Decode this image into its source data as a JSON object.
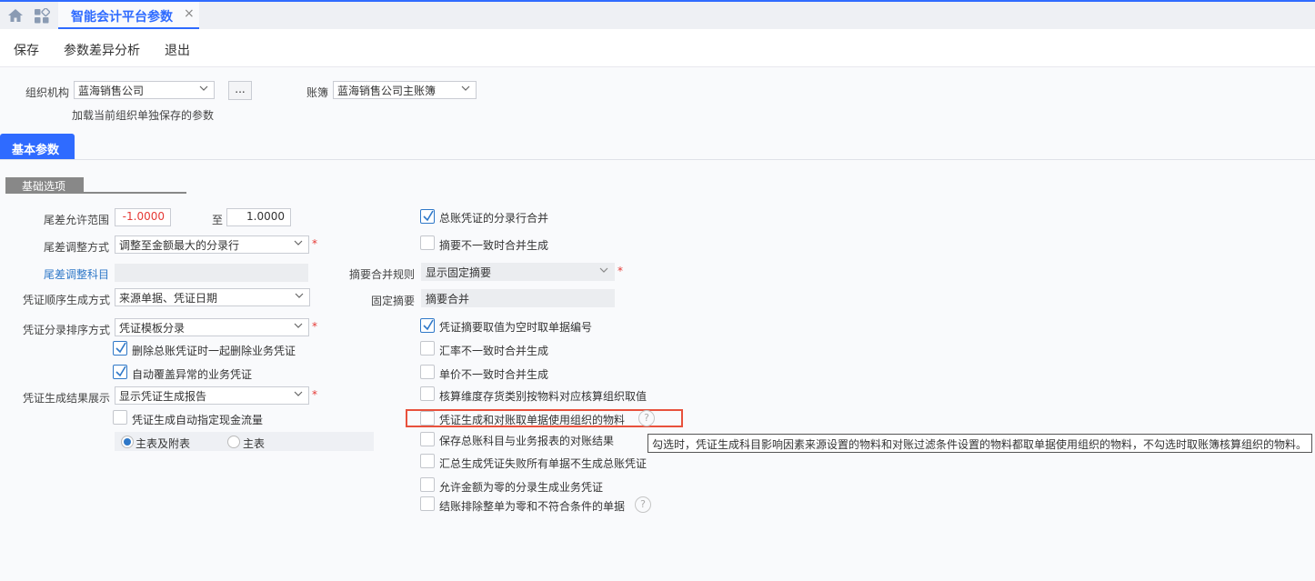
{
  "tabs": {
    "active_title": "智能会计平台参数",
    "close_glyph": "×"
  },
  "toolbar": {
    "save": "保存",
    "diff": "参数差异分析",
    "exit": "退出"
  },
  "org": {
    "label": "组织机构",
    "value": "蓝海销售公司",
    "more": "...",
    "load_note": "加载当前组织单独保存的参数"
  },
  "book": {
    "label": "账簿",
    "value": "蓝海销售公司主账簿"
  },
  "basic_tab": "基本参数",
  "section": "基础选项",
  "left": {
    "tail_range_label": "尾差允许范围",
    "tail_min": "-1.0000",
    "to": "至",
    "tail_max": "1.0000",
    "tail_adjust_label": "尾差调整方式",
    "tail_adjust_value": "调整至金额最大的分录行",
    "tail_account_label": "尾差调整科目",
    "tail_account_value": "",
    "seq_label": "凭证顺序生成方式",
    "seq_value": "来源单据、凭证日期",
    "sort_label": "凭证分录排序方式",
    "sort_value": "凭证模板分录",
    "cb_delete": "删除总账凭证时一起删除业务凭证",
    "cb_overwrite": "自动覆盖异常的业务凭证",
    "result_label": "凭证生成结果展示",
    "result_value": "显示凭证生成报告",
    "cb_cashflow": "凭证生成自动指定现金流量",
    "radio_main_attach": "主表及附表",
    "radio_main": "主表",
    "star": "*"
  },
  "right": {
    "cb_merge": "总账凭证的分录行合并",
    "cb_summary_diff": "摘要不一致时合并生成",
    "summary_rule_label": "摘要合并规则",
    "summary_rule_value": "显示固定摘要",
    "fixed_summary_label": "固定摘要",
    "fixed_summary_value": "摘要合并",
    "cb_summary_empty": "凭证摘要取值为空时取单据编号",
    "cb_rate_diff": "汇率不一致时合并生成",
    "cb_price_diff": "单价不一致时合并生成",
    "cb_dim": "核算维度存货类别按物料对应核算组织取值",
    "cb_material": "凭证生成和对账取单据使用组织的物料",
    "cb_recon": "保存总账科目与业务报表的对账结果",
    "cb_fail": "汇总生成凭证失败所有单据不生成总账凭证",
    "cb_zero": "允许金额为零的分录生成业务凭证",
    "cb_close": "结账排除整单为零和不符合条件的单据",
    "help": "?"
  },
  "tooltip": "勾选时，凭证生成科目影响因素来源设置的物料和对账过滤条件设置的物料都取单据使用组织的物料，不勾选时取账簿核算组织的物料。",
  "colors": {
    "accent": "#2f6bff",
    "link": "#2f78c8",
    "required": "#e53935",
    "highlight": "#e8513c",
    "negative": "#e53935"
  },
  "icons": [
    "home-icon",
    "apps-icon",
    "chevron-down-icon",
    "check-icon",
    "help-icon"
  ]
}
